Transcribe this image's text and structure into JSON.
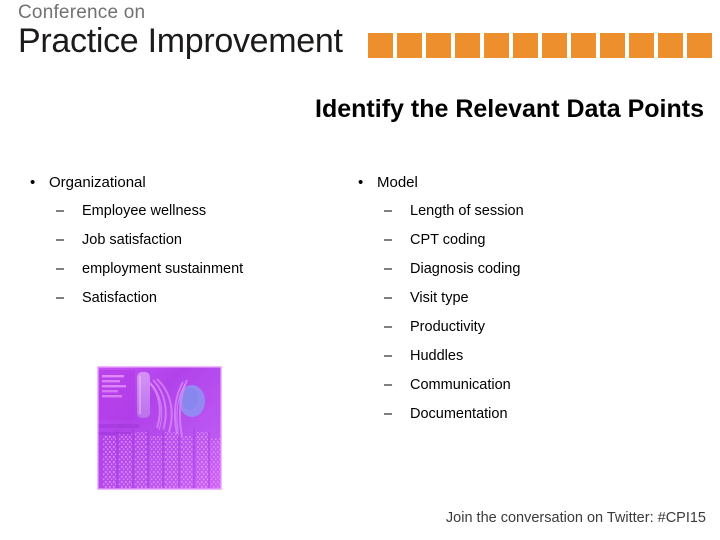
{
  "slide": {
    "title": "Identify the Relevant Data Points"
  },
  "header": {
    "logo_line1": "Conference on",
    "logo_line2": "Practice Improvement",
    "accent_color": "#ed8f2c",
    "square_count": 12,
    "squares_name": "orange-square-strip"
  },
  "content": {
    "columns": [
      {
        "marker": "•",
        "heading": "Organizational",
        "sub_marker": "–",
        "items": [
          "Employee wellness",
          "Job satisfaction",
          "employment sustainment",
          "Satisfaction"
        ]
      },
      {
        "marker": "•",
        "heading": "Model",
        "sub_marker": "–",
        "items": [
          "Length of session",
          "CPT coding",
          "Diagnosis coding",
          "Visit type",
          "Productivity",
          "Huddles",
          "Communication",
          "Documentation"
        ]
      }
    ]
  },
  "media": {
    "circuit_photo_alt": "circuit-board-photo"
  },
  "footer": {
    "twitter_text": "Join the conversation on Twitter: #CPI15"
  }
}
